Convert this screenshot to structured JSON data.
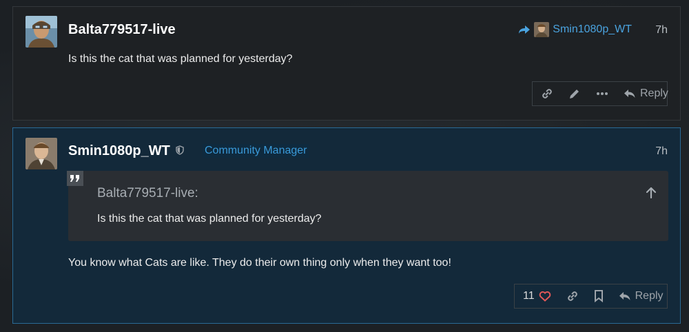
{
  "posts": [
    {
      "username": "Balta779517-live",
      "avatar_icon": "pilot-avatar-icon",
      "reply_to_user": "Smin1080p_WT",
      "timestamp": "7h",
      "text": "Is this the cat that was planned for yesterday?",
      "actions": {
        "reply_label": "Reply"
      }
    },
    {
      "username": "Smin1080p_WT",
      "avatar_icon": "officer-avatar-icon",
      "role": "Community Manager",
      "timestamp": "7h",
      "quote": {
        "author": "Balta779517-live:",
        "text": "Is this the cat that was planned for yesterday?"
      },
      "text": "You know what Cats are like. They do their own thing only when they want too!",
      "actions": {
        "like_count": "11",
        "reply_label": "Reply"
      }
    }
  ],
  "colors": {
    "accent": "#4aa3df",
    "highlight_border": "#2a6a95",
    "heart": "#e05858"
  }
}
